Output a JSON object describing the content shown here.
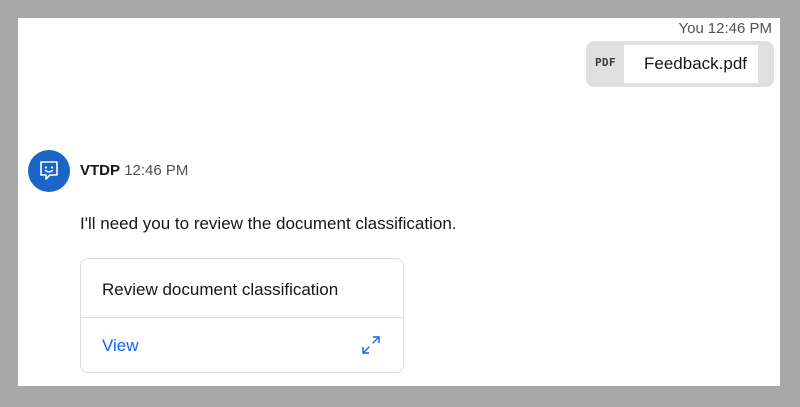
{
  "user_message": {
    "sender": "You",
    "time": "12:46 PM",
    "attachment": {
      "type_label": "PDF",
      "file_name": "Feedback.pdf"
    }
  },
  "bot_message": {
    "sender": "VTDP",
    "time": "12:46 PM",
    "avatar_icon": "chat-bot-icon",
    "text": "I'll need you to review the document classification.",
    "card": {
      "title": "Review document classification",
      "action_label": "View",
      "action_icon": "expand-icon"
    }
  },
  "colors": {
    "background_frame": "#a8a8a8",
    "avatar": "#1b65c8",
    "link": "#0f62fe",
    "file_pill": "#e0e0e0"
  }
}
